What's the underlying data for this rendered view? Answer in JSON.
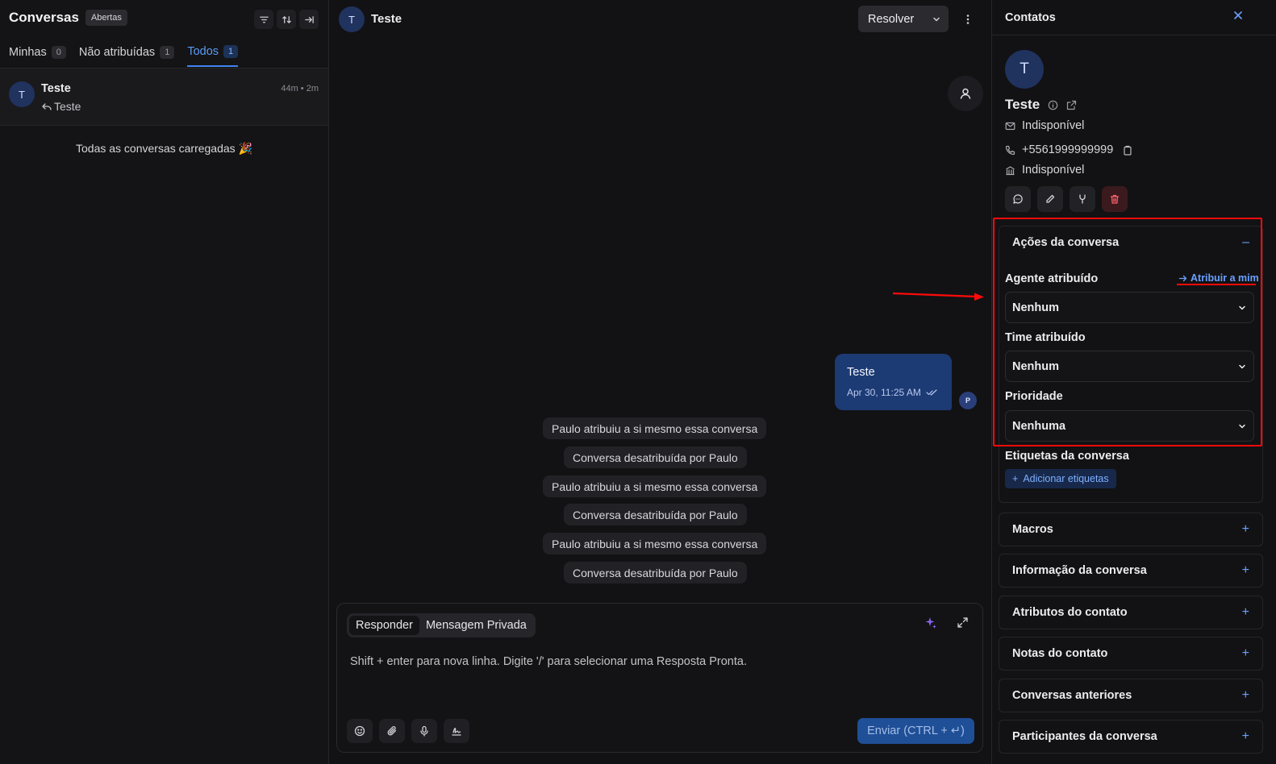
{
  "left": {
    "title": "Conversas",
    "status_badge": "Abertas",
    "tabs": [
      {
        "label": "Minhas",
        "count": "0"
      },
      {
        "label": "Não atribuídas",
        "count": "1"
      },
      {
        "label": "Todos",
        "count": "1",
        "active": true
      }
    ],
    "conversations": [
      {
        "avatar": "T",
        "name": "Teste",
        "time": "44m • 2m",
        "preview": "Teste"
      }
    ],
    "loaded_message": "Todas as conversas carregadas 🎉"
  },
  "chat": {
    "avatar": "T",
    "title": "Teste",
    "resolve_label": "Resolver",
    "message": {
      "text": "Teste",
      "time": "Apr 30, 11:25 AM",
      "sender_initial": "P"
    },
    "activities": [
      "Paulo atribuiu a si mesmo essa conversa",
      "Conversa desatribuída por Paulo",
      "Paulo atribuiu a si mesmo essa conversa",
      "Conversa desatribuída por Paulo",
      "Paulo atribuiu a si mesmo essa conversa",
      "Conversa desatribuída por Paulo"
    ],
    "composer": {
      "tab_reply": "Responder",
      "tab_private": "Mensagem Privada",
      "placeholder": "Shift + enter para nova linha. Digite '/' para selecionar uma Resposta Pronta.",
      "send_label": "Enviar (CTRL + ↵)"
    }
  },
  "contact": {
    "panel_title": "Contatos",
    "avatar": "T",
    "name": "Teste",
    "email": "Indisponível",
    "phone": "+5561999999999",
    "company": "Indisponível"
  },
  "sections": {
    "actions_title": "Ações da conversa",
    "agent_label": "Agente atribuído",
    "assign_me": "Atribuir a mim",
    "agent_value": "Nenhum",
    "team_label": "Time atribuído",
    "team_value": "Nenhum",
    "priority_label": "Prioridade",
    "priority_value": "Nenhuma",
    "tags_label": "Etiquetas da conversa",
    "add_tags": "Adicionar etiquetas",
    "collapsed": [
      "Macros",
      "Informação da conversa",
      "Atributos do contato",
      "Notas do contato",
      "Conversas anteriores",
      "Participantes da conversa"
    ]
  },
  "colors": {
    "accent": "#3f83f0",
    "highlight": "#ff0a0a",
    "bubble": "#1c3a73",
    "danger": "#ff5f6d"
  }
}
